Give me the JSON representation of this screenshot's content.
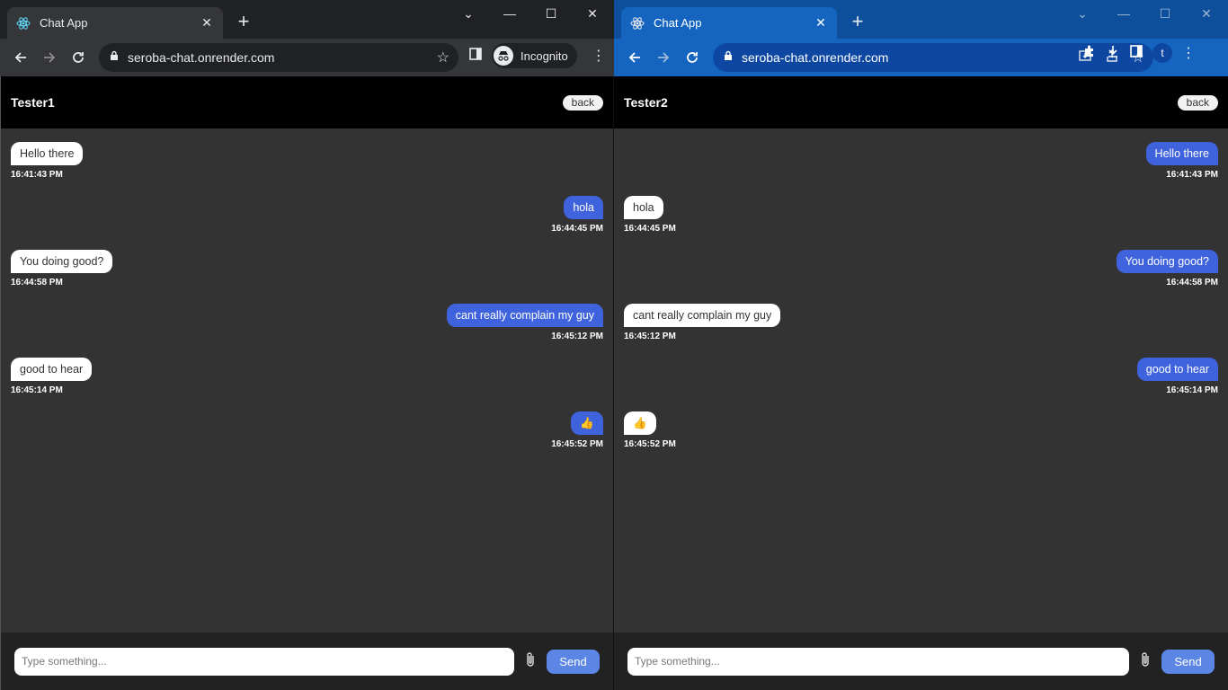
{
  "left": {
    "tab_title": "Chat App",
    "url": "seroba-chat.onrender.com",
    "incognito_label": "Incognito",
    "username": "Tester1",
    "back_label": "back",
    "placeholder": "Type something...",
    "send_label": "Send",
    "messages": [
      {
        "text": "Hello there",
        "time": "16:41:43 PM"
      },
      {
        "text": "hola",
        "time": "16:44:45 PM"
      },
      {
        "text": "You doing good?",
        "time": "16:44:58 PM"
      },
      {
        "text": "cant really complain my guy",
        "time": "16:45:12 PM"
      },
      {
        "text": "good to hear",
        "time": "16:45:14 PM"
      },
      {
        "text": "👍",
        "time": "16:45:52 PM"
      }
    ]
  },
  "right": {
    "tab_title": "Chat App",
    "url": "seroba-chat.onrender.com",
    "profile_initial": "t",
    "username": "Tester2",
    "back_label": "back",
    "placeholder": "Type something...",
    "send_label": "Send",
    "messages": [
      {
        "text": "Hello there",
        "time": "16:41:43 PM"
      },
      {
        "text": "hola",
        "time": "16:44:45 PM"
      },
      {
        "text": "You doing good?",
        "time": "16:44:58 PM"
      },
      {
        "text": "cant really complain my guy",
        "time": "16:45:12 PM"
      },
      {
        "text": "good to hear",
        "time": "16:45:14 PM"
      },
      {
        "text": "👍",
        "time": "16:45:52 PM"
      }
    ]
  },
  "colors": {
    "sent_bubble": "#3f63dc",
    "received_bubble": "#ffffff",
    "chat_bg": "#333333",
    "header_bg": "#000000",
    "send_button": "#5b86e5"
  }
}
